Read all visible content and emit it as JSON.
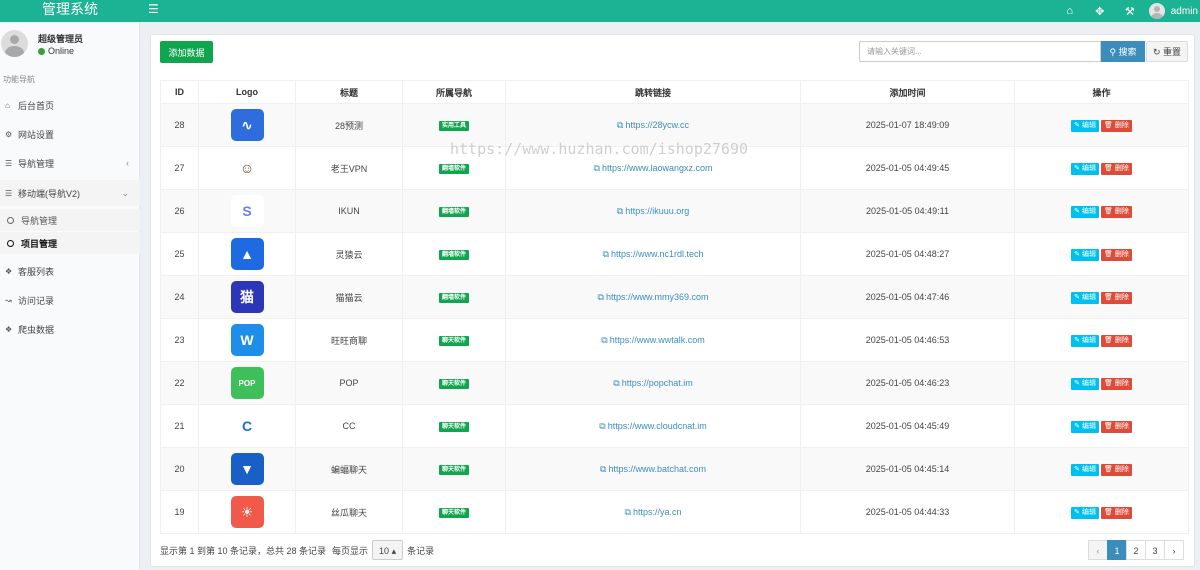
{
  "header": {
    "brand": "管理系统",
    "user": "admin",
    "icons": [
      "home-icon",
      "expand-icon",
      "wrench-icon"
    ]
  },
  "sidebar": {
    "user_name": "超级管理员",
    "user_status": "Online",
    "nav_header": "功能导航",
    "items": [
      {
        "label": "后台首页",
        "icon": "home-icon"
      },
      {
        "label": "网站设置",
        "icon": "gears-icon"
      },
      {
        "label": "导航管理",
        "icon": "database-icon"
      },
      {
        "label": "移动端(导航V2)",
        "icon": "database-icon"
      },
      {
        "label": "客服列表",
        "icon": "tags-icon"
      },
      {
        "label": "访问记录",
        "icon": "chart-icon"
      },
      {
        "label": "爬虫数据",
        "icon": "tags-icon"
      }
    ],
    "sub_items": [
      {
        "label": "导航管理"
      },
      {
        "label": "项目管理"
      }
    ]
  },
  "toolbar": {
    "add_label": "添加数据",
    "search_placeholder": "请输入关键词...",
    "search_label": "搜索",
    "reset_label": "重置"
  },
  "table": {
    "headers": [
      "ID",
      "Logo",
      "标题",
      "所属导航",
      "跳转链接",
      "添加时间",
      "操作"
    ],
    "edit_label": "编辑",
    "delete_label": "删除",
    "rows": [
      {
        "id": "28",
        "title": "28预测",
        "tag": "实用工具",
        "link": "https://28ycw.cc",
        "time": "2025-01-07 18:49:09",
        "logo_color": "#2f6ddf"
      },
      {
        "id": "27",
        "title": "老王VPN",
        "tag": "翻墙软件",
        "link": "https://www.laowangxz.com",
        "time": "2025-01-05 04:49:45",
        "logo_color": "#ffffff"
      },
      {
        "id": "26",
        "title": "IKUN",
        "tag": "翻墙软件",
        "link": "https://ikuuu.org",
        "time": "2025-01-05 04:49:11",
        "logo_color": "#ffffff"
      },
      {
        "id": "25",
        "title": "灵猿云",
        "tag": "翻墙软件",
        "link": "https://www.nc1rdl.tech",
        "time": "2025-01-05 04:48:27",
        "logo_color": "#1e6ae0"
      },
      {
        "id": "24",
        "title": "猫猫云",
        "tag": "翻墙软件",
        "link": "https://www.mmy369.com",
        "time": "2025-01-05 04:47:46",
        "logo_color": "#2b36b8"
      },
      {
        "id": "23",
        "title": "旺旺商聊",
        "tag": "聊天软件",
        "link": "https://www.wwtalk.com",
        "time": "2025-01-05 04:46:53",
        "logo_color": "#1e8ee8"
      },
      {
        "id": "22",
        "title": "POP",
        "tag": "聊天软件",
        "link": "https://popchat.im",
        "time": "2025-01-05 04:46:23",
        "logo_color": "#3fbf5a"
      },
      {
        "id": "21",
        "title": "CC",
        "tag": "聊天软件",
        "link": "https://www.cloudcnat.im",
        "time": "2025-01-05 04:45:49",
        "logo_color": "#ffffff"
      },
      {
        "id": "20",
        "title": "蝙蝠聊天",
        "tag": "聊天软件",
        "link": "https://www.batchat.com",
        "time": "2025-01-05 04:45:14",
        "logo_color": "#1a5fc5"
      },
      {
        "id": "19",
        "title": "丝瓜聊天",
        "tag": "聊天软件",
        "link": "https://ya.cn",
        "time": "2025-01-05 04:44:33",
        "logo_color": "#f05a4a"
      }
    ]
  },
  "footer": {
    "info_text": "显示第 1 到第 10 条记录，总共 28 条记录",
    "per_page_prefix": "每页显示",
    "per_page_value": "10",
    "per_page_suffix": "条记录",
    "pages": [
      "‹",
      "1",
      "2",
      "3",
      "›"
    ],
    "current_page": "1"
  },
  "watermark": "https://www.huzhan.com/ishop27690"
}
